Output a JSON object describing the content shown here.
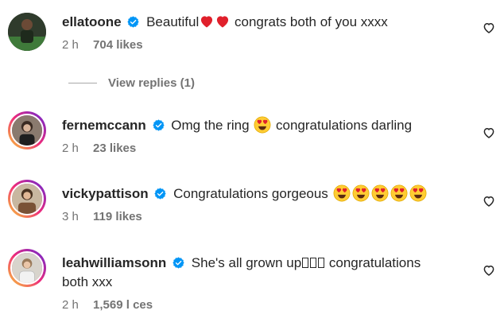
{
  "comments": [
    {
      "username": "ellatoone",
      "text_before": "Beautiful",
      "text_after": " congrats both of you xxxx",
      "time": "2 h",
      "likes": "704 likes",
      "replies": "View replies (1)"
    },
    {
      "username": "fernemccann",
      "text_before": "Omg the ring ",
      "text_after": " congratulations darling",
      "time": "2 h",
      "likes": "23 likes"
    },
    {
      "username": "vickypattison",
      "text_before": "Congratulations gorgeous ",
      "time": "3 h",
      "likes": "119 likes"
    },
    {
      "username": "leahwilliamsonn",
      "text_before": "She's all grown up",
      "text_after": " congratulations",
      "text_line2": "both xxx",
      "time": "2 h",
      "likes": "1,569 l  ces"
    }
  ],
  "icons": {
    "verified": "verified-badge-icon",
    "like": "heart-outline-icon",
    "heart_emoji": "red-heart-emoji",
    "face_emoji": "heart-eyes-emoji"
  },
  "colors": {
    "verified": "#0095f6",
    "heart_emoji": "#e0202b",
    "face_emoji": "#ffcc33",
    "meta_text": "#737373"
  }
}
